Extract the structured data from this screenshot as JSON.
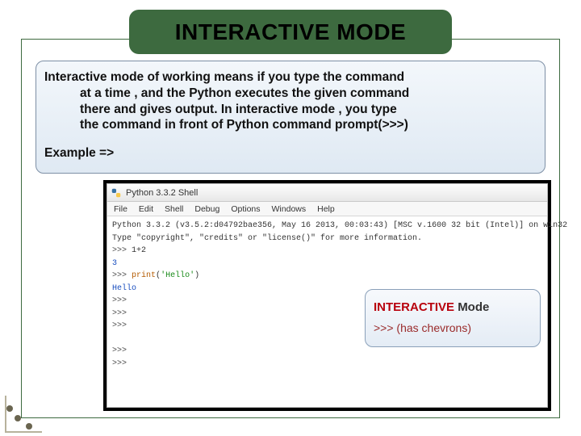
{
  "title": "INTERACTIVE MODE",
  "description": {
    "line1": "Interactive mode of working means if you type the command",
    "line2": "at a time , and the Python executes the given command",
    "line3": "there and gives output. In interactive mode , you type",
    "line4": "the command in front of Python command prompt(>>>)"
  },
  "example_label": "Example =>",
  "shell": {
    "window_title": "Python 3.3.2 Shell",
    "menu": {
      "file": "File",
      "edit": "Edit",
      "shell": "Shell",
      "debug": "Debug",
      "options": "Options",
      "windows": "Windows",
      "help": "Help"
    },
    "banner1": "Python 3.3.2 (v3.5.2:d04792bae356, May 16 2013, 00:03:43) [MSC v.1600 32 bit (Intel)] on win32",
    "banner2": "Type \"copyright\", \"credits\" or \"license()\" for more information.",
    "input1": "1+2",
    "output1": "3",
    "input2_kw": "print",
    "input2_str": "'Hello'",
    "output2": "Hello",
    "prompt": ">>>"
  },
  "callout": {
    "strong": "INTERACTIVE",
    "mode_word": "Mode",
    "line2": ">>> (has chevrons)"
  }
}
